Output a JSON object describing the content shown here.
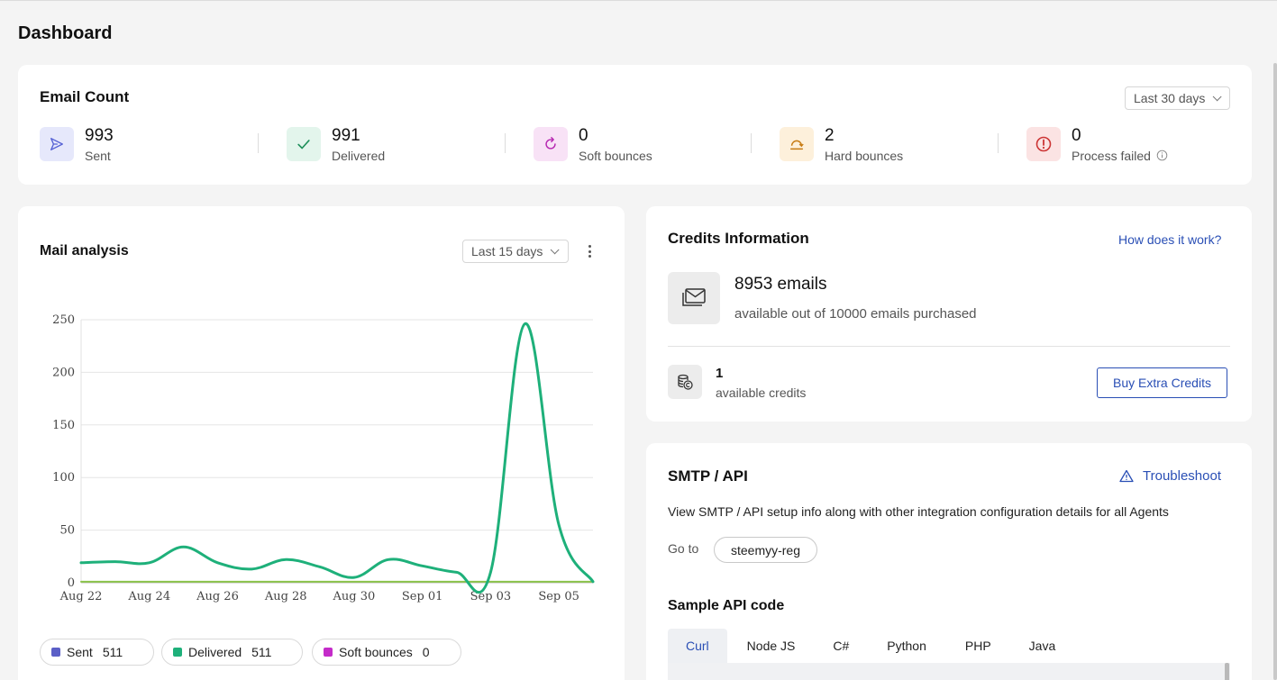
{
  "page": {
    "title": "Dashboard"
  },
  "email_count": {
    "title": "Email Count",
    "range": "Last 30 days",
    "stats": [
      {
        "value": "993",
        "label": "Sent",
        "icon": "send-icon",
        "color": "#5561d4",
        "bg": "#e6e8fb"
      },
      {
        "value": "991",
        "label": "Delivered",
        "icon": "check-icon",
        "color": "#1e8f5a",
        "bg": "#e3f5ec"
      },
      {
        "value": "0",
        "label": "Soft bounces",
        "icon": "refresh-icon",
        "color": "#b627b1",
        "bg": "#f8e2f6"
      },
      {
        "value": "2",
        "label": "Hard bounces",
        "icon": "bounce-back-icon",
        "color": "#c77b13",
        "bg": "#fdf0db"
      },
      {
        "value": "0",
        "label": "Process failed",
        "icon": "alert-circle-icon",
        "color": "#cc3434",
        "bg": "#fbe3e3"
      }
    ]
  },
  "mail_analysis": {
    "title": "Mail analysis",
    "range": "Last 15 days",
    "legend": [
      {
        "label": "Sent",
        "value": "511",
        "color": "#5b5fc7"
      },
      {
        "label": "Delivered",
        "value": "511",
        "color": "#1eb07a"
      },
      {
        "label": "Soft bounces",
        "value": "0",
        "color": "#c42bc9"
      }
    ]
  },
  "chart_data": {
    "type": "line",
    "x": [
      "Aug 22",
      "Aug 23",
      "Aug 24",
      "Aug 25",
      "Aug 26",
      "Aug 27",
      "Aug 28",
      "Aug 29",
      "Aug 30",
      "Aug 31",
      "Sep 01",
      "Sep 02",
      "Sep 03",
      "Sep 04",
      "Sep 05",
      "Sep 06"
    ],
    "x_tick_labels": [
      "Aug 22",
      "Aug 24",
      "Aug 26",
      "Aug 28",
      "Aug 30",
      "Sep 01",
      "Sep 03",
      "Sep 05"
    ],
    "y_ticks": [
      "0",
      "50",
      "100",
      "150",
      "200",
      "250"
    ],
    "ylim": [
      0,
      250
    ],
    "grid": true,
    "series": [
      {
        "color": "#1eb07a",
        "values": [
          19,
          20,
          19,
          34,
          19,
          13,
          22,
          15,
          5,
          22,
          16,
          10,
          10,
          246,
          55,
          1
        ]
      },
      {
        "color": "#8bc34a",
        "values": [
          1,
          1,
          1,
          1,
          1,
          1,
          1,
          1,
          1,
          1,
          1,
          1,
          1,
          1,
          1,
          1
        ]
      }
    ]
  },
  "credits": {
    "title": "Credits Information",
    "help_link": "How does it work?",
    "emails_count": "8953 emails",
    "emails_sub": "available out of 10000 emails purchased",
    "credits_count": "1",
    "credits_sub": "available credits",
    "buy_button": "Buy Extra Credits"
  },
  "smtp": {
    "title": "SMTP / API",
    "troubleshoot": "Troubleshoot",
    "description": "View SMTP / API setup info along with other integration configuration details for all Agents",
    "goto_label": "Go to",
    "agent_chip": "steemyy-reg",
    "sample_title": "Sample API code",
    "tabs": [
      "Curl",
      "Node JS",
      "C#",
      "Python",
      "PHP",
      "Java"
    ],
    "active_tab": "Curl"
  }
}
